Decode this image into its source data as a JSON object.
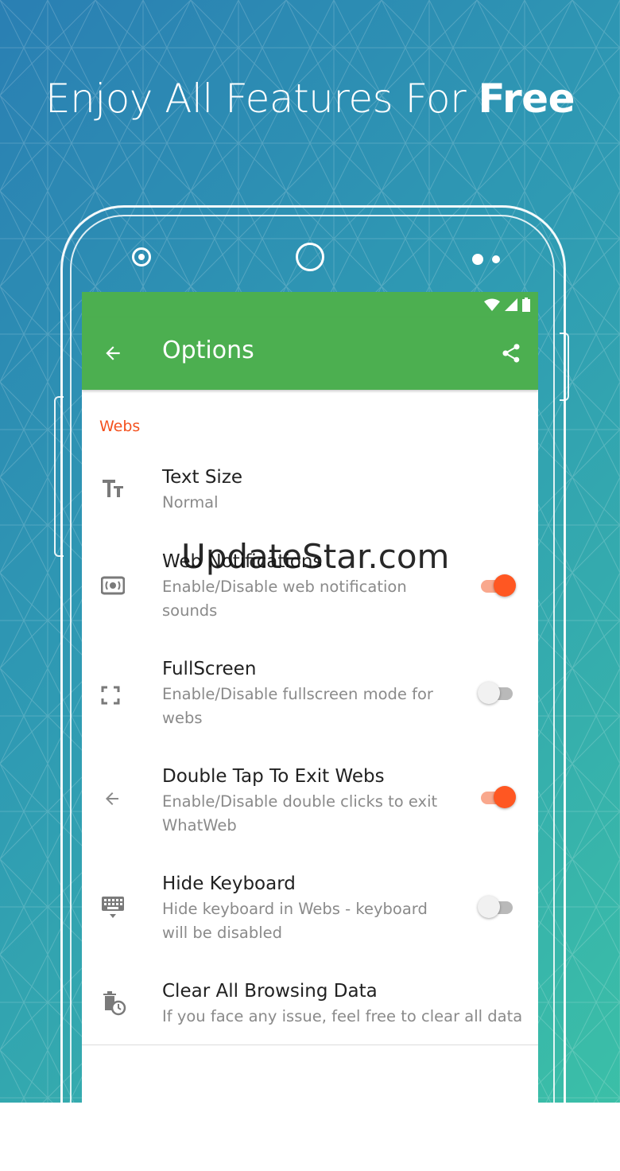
{
  "headline": {
    "prefix": "Enjoy All Features For ",
    "emphasis": "Free"
  },
  "appbar": {
    "title": "Options"
  },
  "section_header": "Webs",
  "settings": [
    {
      "title": "Text Size",
      "subtitle": "Normal",
      "icon": "text-size-icon"
    },
    {
      "title": "Web Notifications",
      "subtitle": "Enable/Disable web notification sounds",
      "icon": "notification-sound-icon",
      "toggle": true
    },
    {
      "title": "FullScreen",
      "subtitle": "Enable/Disable fullscreen mode for webs",
      "icon": "fullscreen-icon",
      "toggle": false
    },
    {
      "title": "Double Tap To Exit Webs",
      "subtitle": "Enable/Disable double clicks to exit WhatWeb",
      "icon": "arrow-left-icon",
      "toggle": true
    },
    {
      "title": "Hide Keyboard",
      "subtitle": "Hide keyboard in Webs - keyboard will be disabled",
      "icon": "keyboard-icon",
      "toggle": false
    },
    {
      "title": "Clear All Browsing Data",
      "subtitle": "If you face any issue, feel free to clear all data",
      "icon": "clear-data-icon"
    }
  ],
  "watermark": "UpdateStar.com",
  "colors": {
    "accent": "#ff5722",
    "appbar": "#4caf50",
    "section": "#f4511e"
  }
}
